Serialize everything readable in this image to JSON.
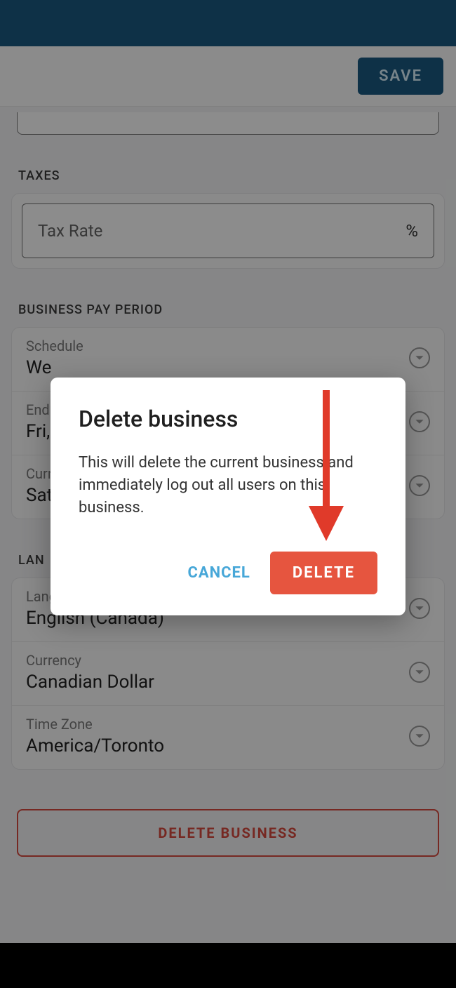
{
  "header": {
    "save_label": "SAVE"
  },
  "taxes": {
    "section_label": "TAXES",
    "rate_placeholder": "Tax Rate",
    "unit": "%"
  },
  "pay_period": {
    "section_label": "BUSINESS PAY PERIOD",
    "rows": [
      {
        "label": "Schedule",
        "value": "We"
      },
      {
        "label": "End",
        "value": "Fri,"
      },
      {
        "label": "Curr",
        "value": "Sat"
      }
    ]
  },
  "lang_region": {
    "section_label": "LAN",
    "rows": [
      {
        "label": "Language",
        "value": "English (Canada)"
      },
      {
        "label": "Currency",
        "value": "Canadian Dollar"
      },
      {
        "label": "Time Zone",
        "value": "America/Toronto"
      }
    ]
  },
  "delete_business_label": "DELETE BUSINESS",
  "dialog": {
    "title": "Delete business",
    "body": "This will delete the current business and immediately log out all users on this business.",
    "cancel_label": "CANCEL",
    "confirm_label": "DELETE"
  },
  "annotation": {
    "arrow_color": "#e03a2a"
  }
}
